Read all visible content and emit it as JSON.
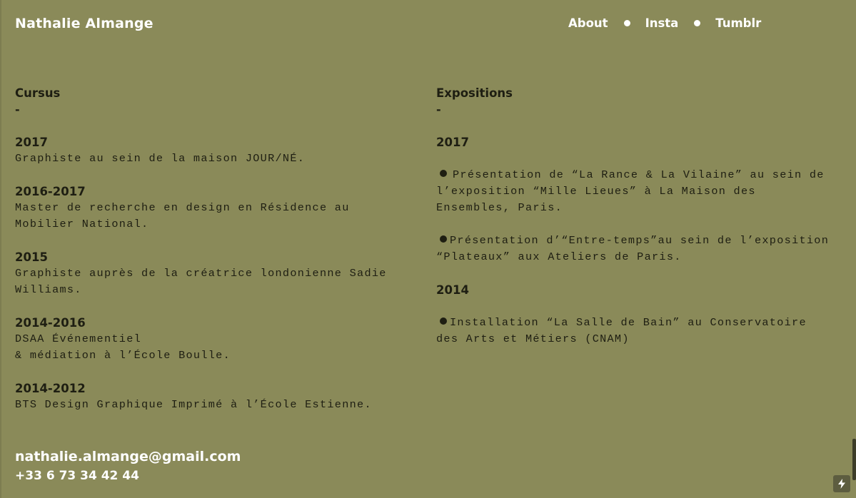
{
  "header": {
    "site_title": "Nathalie Almange",
    "nav": [
      "About",
      "Insta",
      "Tumblr"
    ]
  },
  "cursus": {
    "title": "Cursus",
    "dash": "-",
    "items": [
      {
        "year": "2017",
        "text": "Graphiste au sein de la maison JOUR/NÉ."
      },
      {
        "year": "2016-2017",
        "text": "Master de recherche en design en Résidence au Mobilier National."
      },
      {
        "year": "2015",
        "text": "Graphiste auprès de la créatrice londonienne Sadie Williams."
      },
      {
        "year": "2014-2016",
        "line1": "DSAA Événementiel",
        "line2": "& médiation à l’École Boulle."
      },
      {
        "year": "2014-2012",
        "text": "BTS Design Graphique Imprimé à l’École Estienne."
      }
    ]
  },
  "expositions": {
    "title": "Expositions",
    "dash": "-",
    "years": [
      {
        "year": "2017",
        "items": [
          "Présentation de “La Rance & La Vilaine” au sein de l’exposition “Mille Lieues” à La Maison des Ensembles, Paris.",
          "Présentation d’“Entre-temps”au sein de l’exposition “Plateaux” aux Ateliers de Paris."
        ]
      },
      {
        "year": "2014",
        "items": [
          "Installation “La Salle de Bain” au Conservatoire des Arts et Métiers (CNAM)"
        ]
      }
    ]
  },
  "contact": {
    "email": "nathalie.almange@gmail.com",
    "phone": "+33 6 73 34 42 44"
  },
  "colors": {
    "background": "#8a8a59",
    "text": "#1e1e12",
    "accent_text": "#ffffff"
  },
  "icons": {
    "nav_separator": "dot-icon",
    "list_bullet": "bullet-icon",
    "corner_button": "lightning-bolt-icon"
  }
}
